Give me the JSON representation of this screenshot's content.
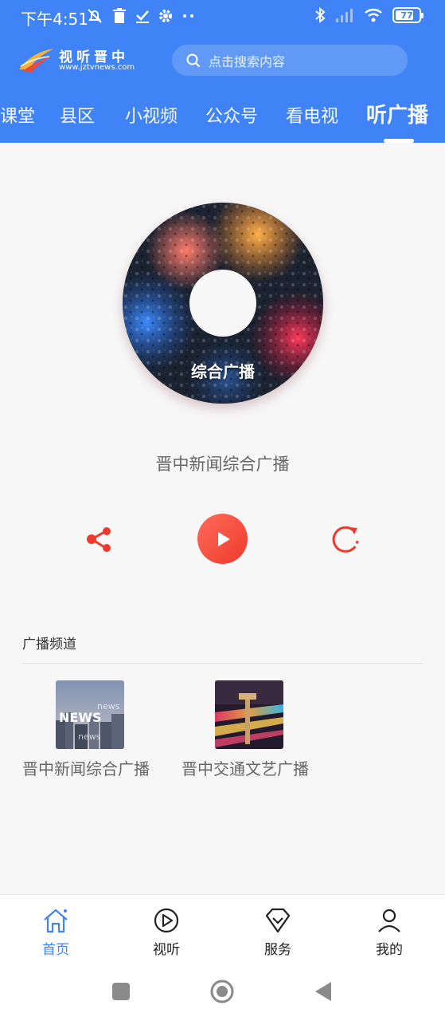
{
  "status_bar": {
    "time": "下午4:51",
    "battery": "77",
    "icons": [
      "alarm-off-icon",
      "trash-icon",
      "check-icon",
      "gear-icon",
      "more-icon",
      "bluetooth-icon",
      "signal-icon",
      "wifi-icon",
      "battery-icon"
    ]
  },
  "header": {
    "logo_title": "视听晋中",
    "logo_subtitle": "www.jztvnews.com",
    "search_placeholder": "点击搜索内容",
    "tabs": [
      {
        "label": "课堂",
        "active": false
      },
      {
        "label": "县区",
        "active": false
      },
      {
        "label": "小视频",
        "active": false
      },
      {
        "label": "公众号",
        "active": false
      },
      {
        "label": "看电视",
        "active": false
      },
      {
        "label": "听广播",
        "active": true
      }
    ]
  },
  "player": {
    "disc_label": "综合广播",
    "station_name": "晋中新闻综合广播",
    "controls": [
      "share-icon",
      "play-icon",
      "reload-icon"
    ]
  },
  "channels": {
    "section_title": "广播频道",
    "items": [
      {
        "label": "晋中新闻综合广播",
        "thumb_text": "NEWS"
      },
      {
        "label": "晋中交通文艺广播",
        "thumb_text": ""
      }
    ]
  },
  "bottom_nav": {
    "items": [
      {
        "label": "首页",
        "icon": "home-icon",
        "active": true
      },
      {
        "label": "视听",
        "icon": "play-circle-icon",
        "active": false
      },
      {
        "label": "服务",
        "icon": "diamond-icon",
        "active": false
      },
      {
        "label": "我的",
        "icon": "user-icon",
        "active": false
      }
    ]
  },
  "colors": {
    "brand_blue": "#3f83f6",
    "accent_red": "#ee3a2c",
    "background": "#f7f7f8"
  }
}
